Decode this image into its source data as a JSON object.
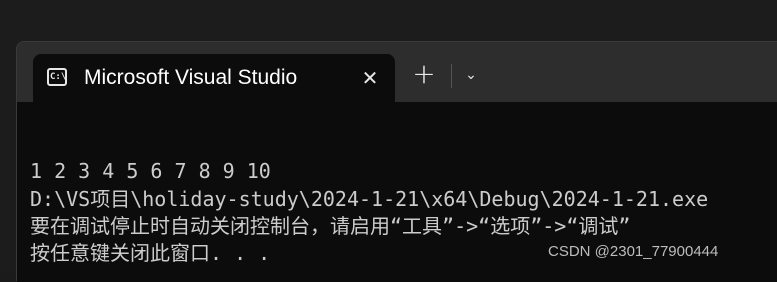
{
  "tab": {
    "icon": "console-icon",
    "icon_glyph": "C:\\",
    "title": "Microsoft Visual Studio",
    "close_glyph": "✕"
  },
  "tabbar": {
    "new_tab_glyph": "+",
    "dropdown_glyph": "⌄"
  },
  "console": {
    "lines": [
      "1 2 3 4 5 6 7 8 9 10",
      "D:\\VS项目\\holiday-study\\2024-1-21\\x64\\Debug\\2024-1-21.exe",
      "要在调试停止时自动关闭控制台，请启用“工具”->“选项”->“调试”",
      "按任意键关闭此窗口. . ."
    ]
  },
  "watermark": "CSDN @2301_77900444",
  "colors": {
    "console_bg": "#0c0c0c",
    "console_text": "#cccccc",
    "titlebar_bg": "#2d2d2d"
  }
}
